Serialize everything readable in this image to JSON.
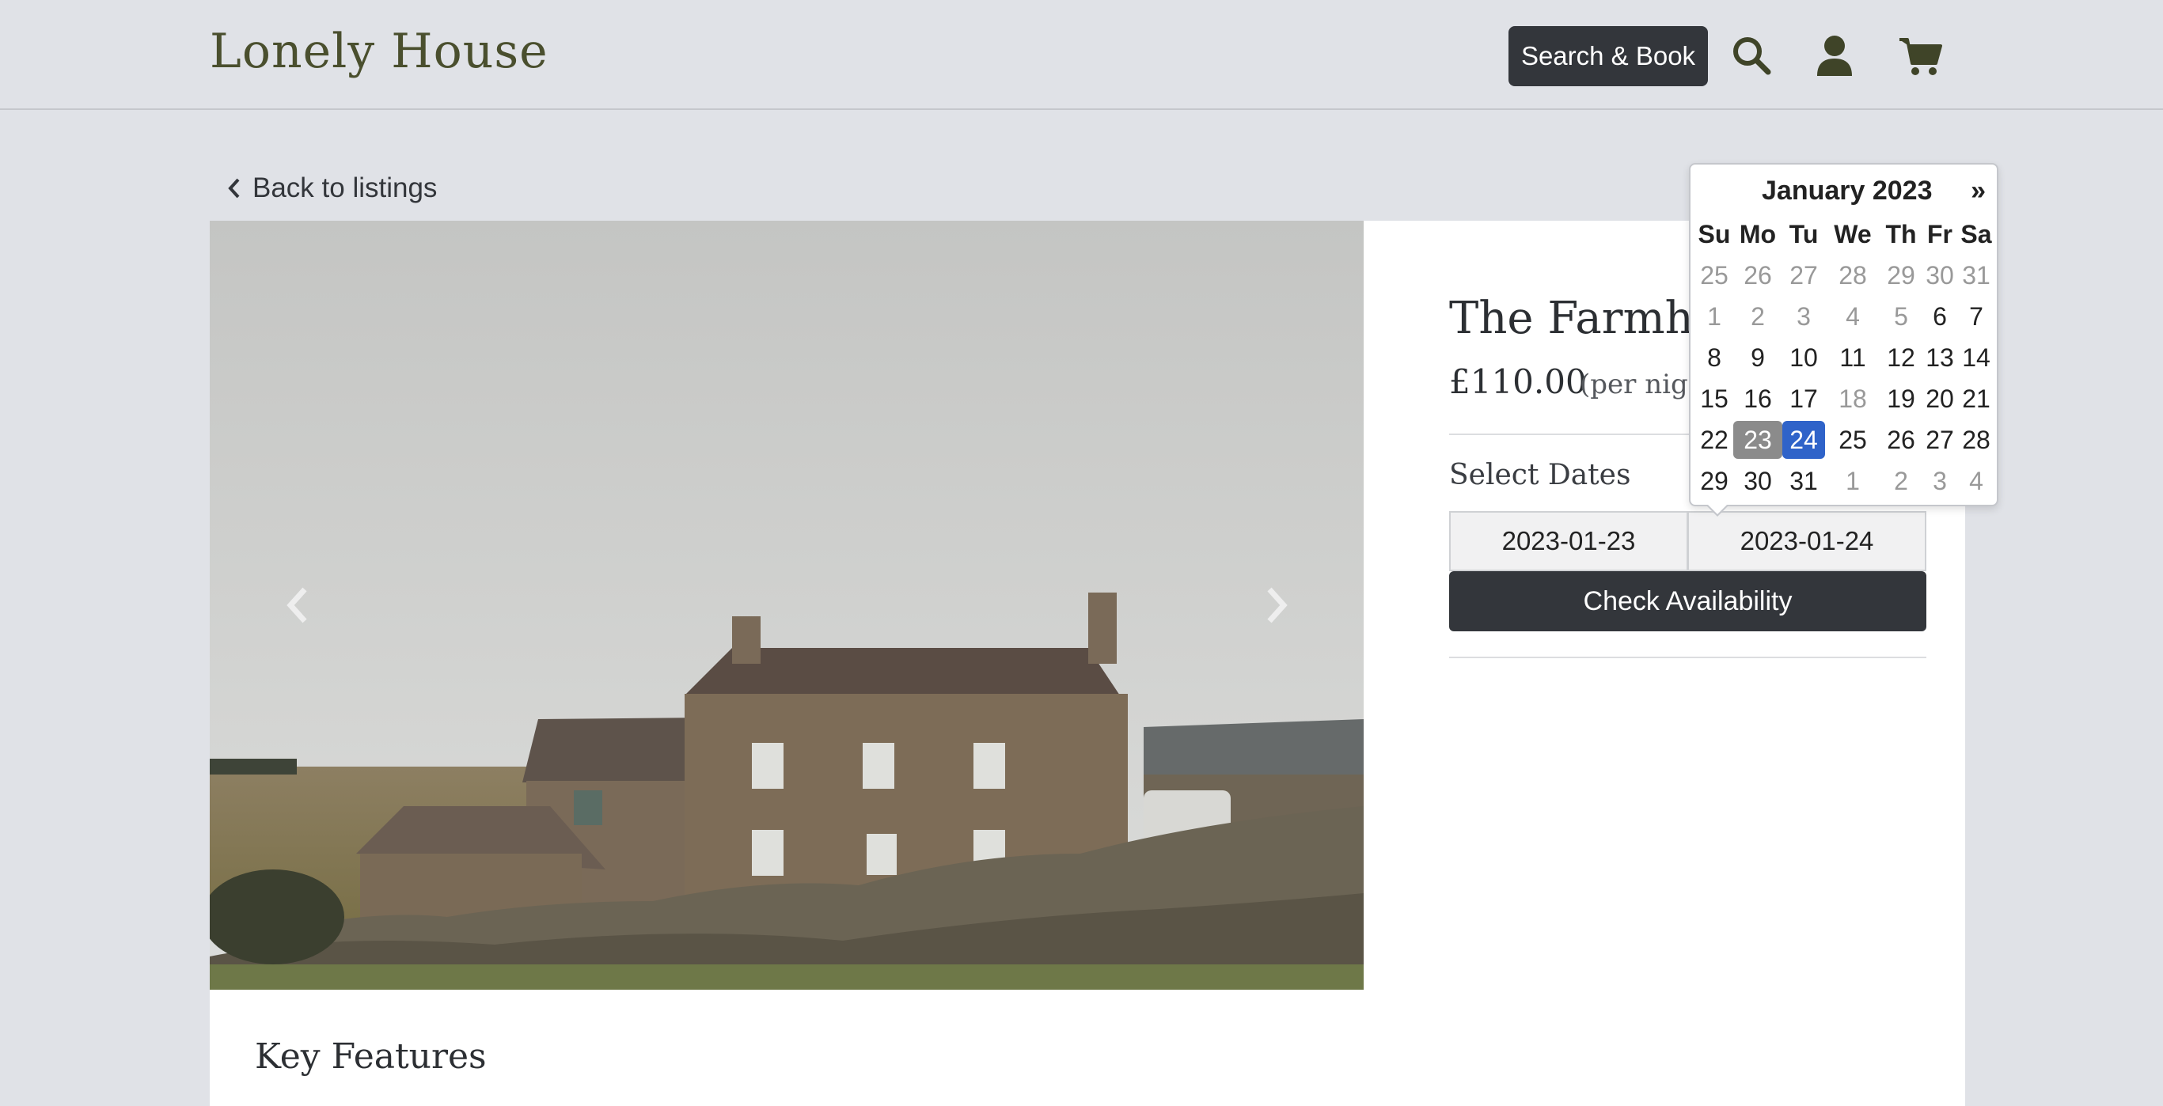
{
  "header": {
    "brand": "Lonely House",
    "search_book_label": "Search & Book",
    "icons": [
      "search-icon",
      "user-icon",
      "cart-icon"
    ]
  },
  "nav": {
    "back_label": "Back to listings"
  },
  "listing": {
    "title": "The Farmhou",
    "price": "£110.00",
    "per_night": "(per nig",
    "select_dates_label": "Select Dates",
    "check_in": "2023-01-23",
    "check_out": "2023-01-24",
    "check_button": "Check Availability",
    "key_features": "Key Features"
  },
  "datepicker": {
    "month_label": "January 2023",
    "next_label": "»",
    "weekdays": [
      "Su",
      "Mo",
      "Tu",
      "We",
      "Th",
      "Fr",
      "Sa"
    ],
    "weeks": [
      [
        {
          "d": "25",
          "m": true
        },
        {
          "d": "26",
          "m": true
        },
        {
          "d": "27",
          "m": true
        },
        {
          "d": "28",
          "m": true
        },
        {
          "d": "29",
          "m": true
        },
        {
          "d": "30",
          "m": true
        },
        {
          "d": "31",
          "m": true
        }
      ],
      [
        {
          "d": "1",
          "m": true
        },
        {
          "d": "2",
          "m": true
        },
        {
          "d": "3",
          "m": true
        },
        {
          "d": "4",
          "m": true
        },
        {
          "d": "5",
          "m": true
        },
        {
          "d": "6"
        },
        {
          "d": "7"
        }
      ],
      [
        {
          "d": "8"
        },
        {
          "d": "9"
        },
        {
          "d": "10"
        },
        {
          "d": "11"
        },
        {
          "d": "12"
        },
        {
          "d": "13"
        },
        {
          "d": "14"
        }
      ],
      [
        {
          "d": "15"
        },
        {
          "d": "16"
        },
        {
          "d": "17"
        },
        {
          "d": "18",
          "m": true
        },
        {
          "d": "19"
        },
        {
          "d": "20"
        },
        {
          "d": "21"
        }
      ],
      [
        {
          "d": "22"
        },
        {
          "d": "23",
          "s": "range"
        },
        {
          "d": "24",
          "s": "active"
        },
        {
          "d": "25"
        },
        {
          "d": "26"
        },
        {
          "d": "27"
        },
        {
          "d": "28"
        }
      ],
      [
        {
          "d": "29"
        },
        {
          "d": "30"
        },
        {
          "d": "31"
        },
        {
          "d": "1",
          "m": true
        },
        {
          "d": "2",
          "m": true
        },
        {
          "d": "3",
          "m": true
        },
        {
          "d": "4",
          "m": true
        }
      ]
    ],
    "range_color": "#8b8b8b",
    "active_color": "#2f63c9"
  },
  "colors": {
    "page_bg": "#e0e2e7",
    "dark_button": "#33363b",
    "brand_text": "#4a4f2e"
  }
}
